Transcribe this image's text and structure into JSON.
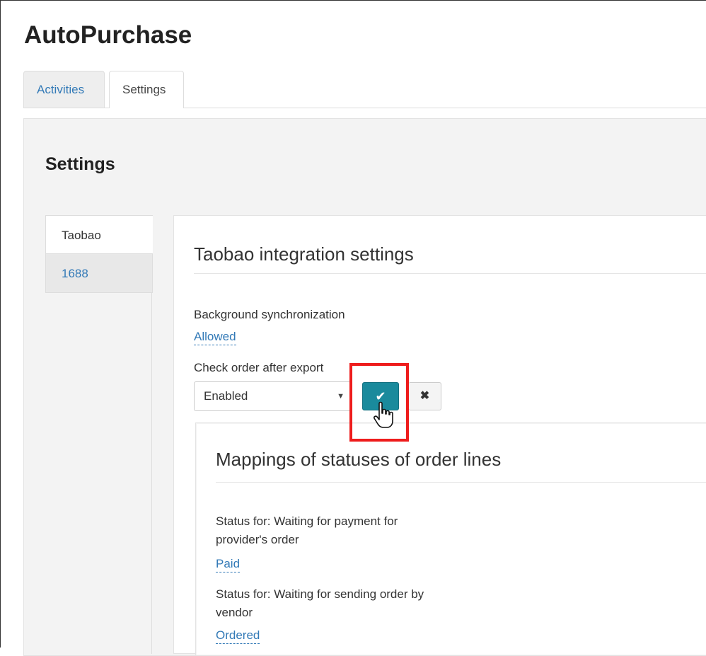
{
  "app": {
    "title": "AutoPurchase"
  },
  "tabs": [
    {
      "label": "Activities",
      "active": false
    },
    {
      "label": "Settings",
      "active": true
    }
  ],
  "settings": {
    "heading": "Settings",
    "nav": [
      {
        "label": "Taobao",
        "active": true
      },
      {
        "label": "1688",
        "active": false
      }
    ]
  },
  "taobao": {
    "title": "Taobao integration settings",
    "background_sync": {
      "label": "Background synchronization",
      "value": "Allowed"
    },
    "check_order": {
      "label": "Check order after export",
      "selected": "Enabled",
      "confirm_icon": "check-icon",
      "cancel_icon": "close-icon"
    },
    "mappings": {
      "title": "Mappings of statuses of order lines",
      "items": [
        {
          "label_line1": "Status for: Waiting for payment for",
          "label_line2": "provider's order",
          "value": "Paid"
        },
        {
          "label_line1": "Status for: Waiting for sending order by",
          "label_line2": "vendor",
          "value": "Ordered"
        }
      ]
    }
  },
  "colors": {
    "accent": "#1a8a9c",
    "link": "#337ab7",
    "highlight": "#ee1c1c"
  }
}
